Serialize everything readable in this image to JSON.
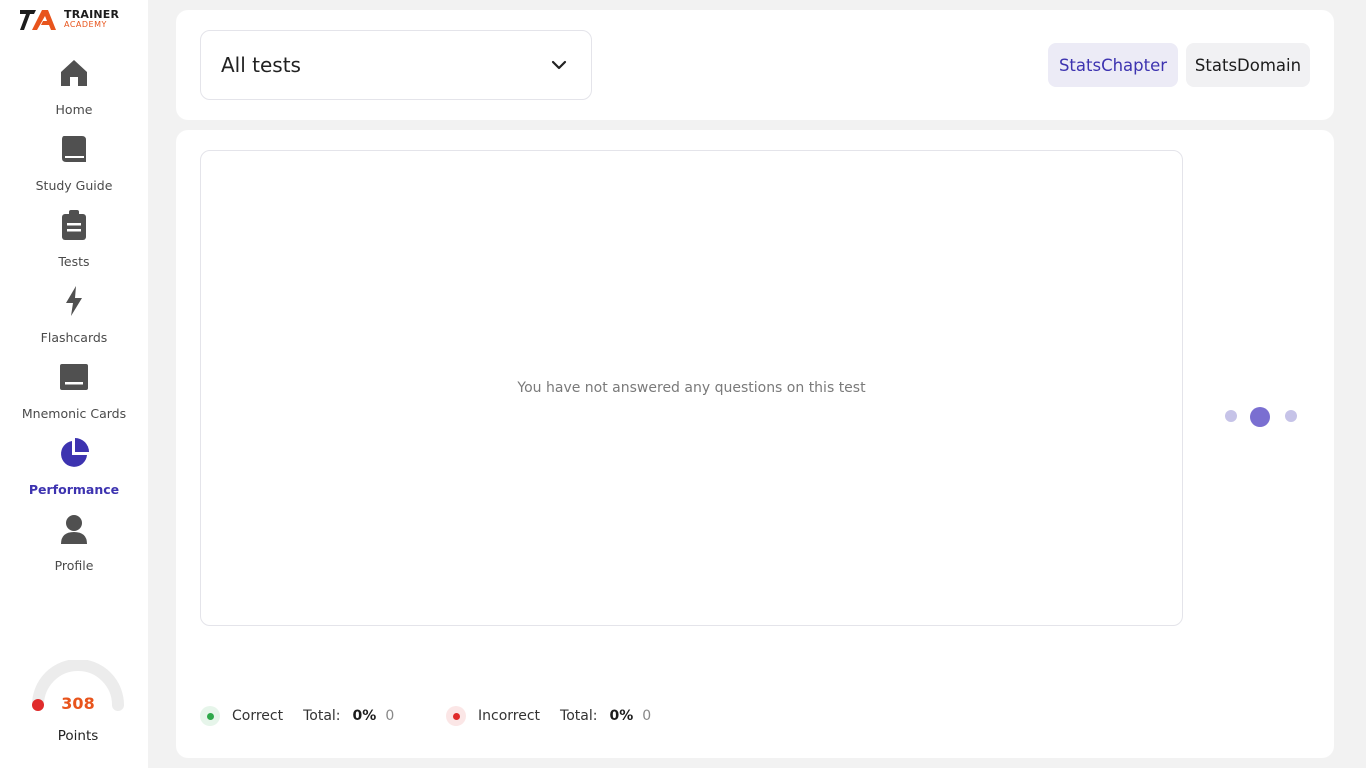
{
  "brand": {
    "name_line1": "TRAINER",
    "name_line2": "ACADEMY",
    "accent_color": "#e8541c"
  },
  "sidebar": {
    "items": [
      {
        "label": "Home",
        "icon": "home-icon"
      },
      {
        "label": "Study Guide",
        "icon": "book-icon"
      },
      {
        "label": "Tests",
        "icon": "clipboard-icon"
      },
      {
        "label": "Flashcards",
        "icon": "lightning-icon"
      },
      {
        "label": "Mnemonic Cards",
        "icon": "card-icon"
      },
      {
        "label": "Performance",
        "icon": "pie-chart-icon",
        "active": true
      },
      {
        "label": "Profile",
        "icon": "user-icon"
      }
    ],
    "active_color": "#3d33b0"
  },
  "points": {
    "value": "308",
    "label": "Points"
  },
  "filters": {
    "test_select_value": "All tests",
    "tab_chapter": "StatsChapter",
    "tab_domain": "StatsDomain",
    "active_tab": "StatsChapter"
  },
  "chart": {
    "empty_message": "You have not answered any questions on this test",
    "carousel_active_index": 1
  },
  "legend": {
    "correct": {
      "label": "Correct",
      "total_label": "Total:",
      "percent": "0%",
      "count": "0",
      "color": "#2ea84a"
    },
    "incorrect": {
      "label": "Incorrect",
      "total_label": "Total:",
      "percent": "0%",
      "count": "0",
      "color": "#e02b2b"
    }
  }
}
